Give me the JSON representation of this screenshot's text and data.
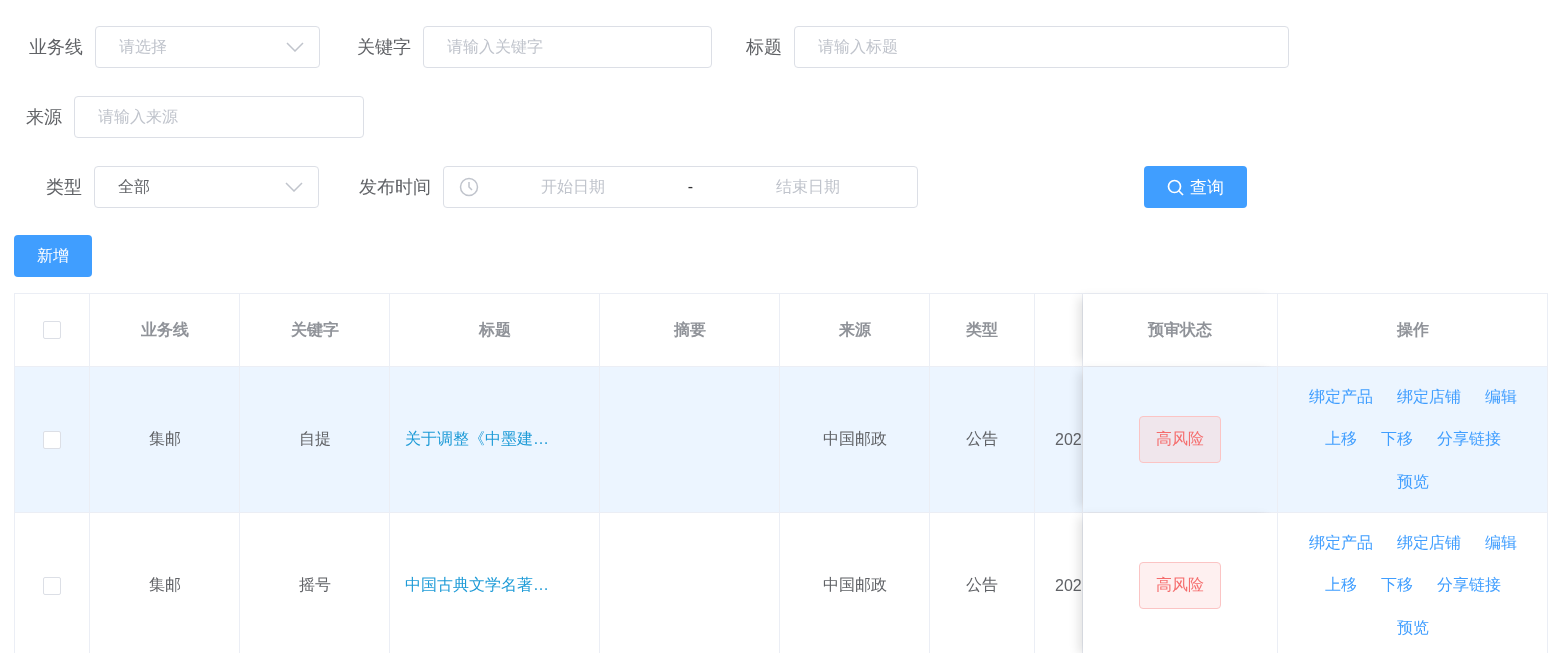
{
  "filter_rows": [
    [
      {
        "kind": "select",
        "label": "业务线",
        "placeholder": "请选择"
      },
      {
        "kind": "input",
        "label": "关键字",
        "placeholder": "请输入关键字"
      },
      {
        "kind": "input",
        "label": "标题",
        "placeholder": "请输入标题"
      }
    ],
    [
      {
        "kind": "input",
        "label": "来源",
        "placeholder": "请输入来源"
      }
    ],
    [
      {
        "kind": "select",
        "label": "类型",
        "value": "全部"
      },
      {
        "kind": "daterange",
        "label": "发布时间",
        "start_placeholder": "开始日期",
        "separator": "-",
        "end_placeholder": "结束日期"
      }
    ]
  ],
  "search_button": {
    "label": "查询"
  },
  "add_button": {
    "label": "新增"
  },
  "table": {
    "header_checked": false,
    "columns": [
      "业务线",
      "关键字",
      "标题",
      "摘要",
      "来源",
      "类型",
      "预审状态",
      "操作"
    ],
    "rows": [
      {
        "checked": false,
        "highlighted": true,
        "business_line": "集邮",
        "keyword": "自提",
        "title": "关于调整《中墨建…",
        "source": "中国邮政",
        "type": "公告",
        "column_8": "202",
        "review_status": "高风险",
        "actions": [
          "绑定产品",
          "绑定店铺",
          "编辑",
          "上移",
          "下移",
          "分享链接",
          "预览"
        ]
      },
      {
        "checked": false,
        "highlighted": false,
        "business_line": "集邮",
        "keyword": "摇号",
        "title": "中国古典文学名著…",
        "source": "中国邮政",
        "type": "公告",
        "column_8": "202",
        "review_status": "高风险",
        "actions": [
          "绑定产品",
          "绑定店铺",
          "编辑",
          "上移",
          "下移",
          "分享链接",
          "预览"
        ]
      }
    ]
  }
}
